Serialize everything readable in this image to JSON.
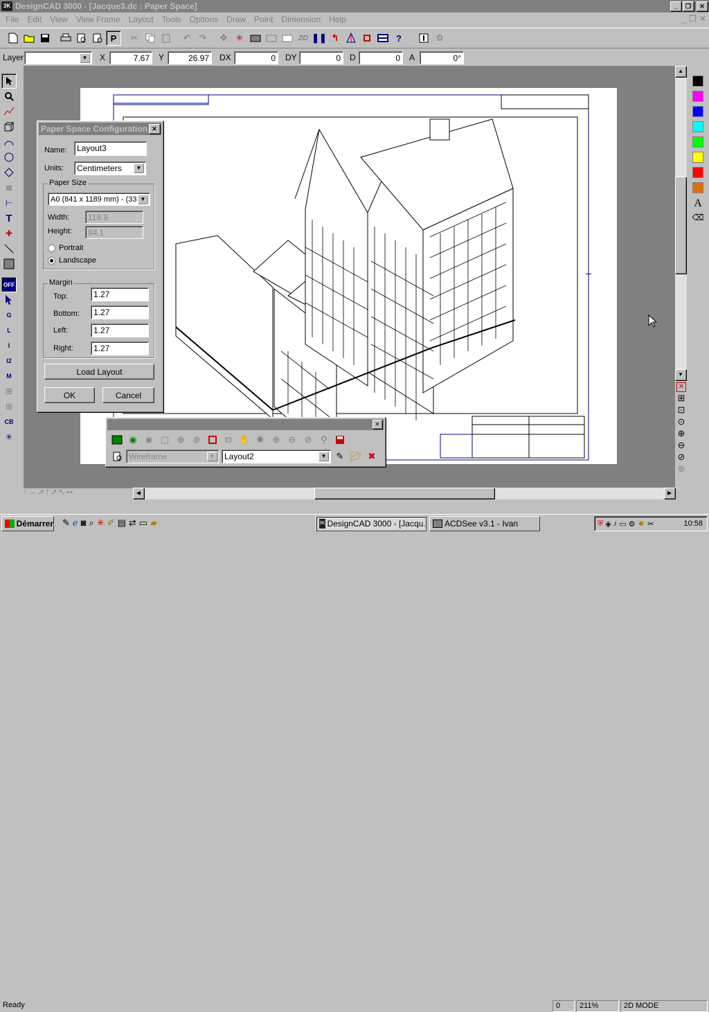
{
  "window": {
    "title": "DesignCAD 3000 - [Jacque3.dc : Paper Space]",
    "app_icon": "3K"
  },
  "title_buttons": {
    "minimize": "_",
    "restore": "❐",
    "close": "✕"
  },
  "menu": [
    "File",
    "Edit",
    "View",
    "View Frame",
    "Layout",
    "Tools",
    "Options",
    "Draw",
    "Point",
    "Dimension",
    "Help"
  ],
  "coordbar": {
    "layer_label": "Layer",
    "layer_value": "",
    "x_label": "X",
    "x": "7.67",
    "y_label": "Y",
    "y": "26.97",
    "dx_label": "DX",
    "dx": "0",
    "dy_label": "DY",
    "dy": "0",
    "d_label": "D",
    "d": "0",
    "a_label": "A",
    "a": "0°"
  },
  "toolbar_icons": [
    "new-file-icon",
    "open-file-icon",
    "save-icon",
    "print-icon",
    "print-preview-icon",
    "page-preview-icon",
    "paper-space-icon",
    "cut-icon",
    "copy-icon",
    "paste-icon",
    "undo-icon",
    "redo-icon",
    "move-icon",
    "explode-icon",
    "render-icon",
    "shade-icon",
    "hatch-icon",
    "2d-icon",
    "pause-icon",
    "arrow-icon",
    "3d-view-icon",
    "snap-icon",
    "layer-icon",
    "help-icon",
    "info-icon",
    "settings-icon"
  ],
  "toolbar_text": {
    "2d": "2D",
    "paper": "P",
    "help": "?"
  },
  "left_tools": {
    "off": "OFF",
    "g": "G",
    "l": "L",
    "i": "I",
    "i2": "I2",
    "m": "M",
    "cb": "CB",
    "text": "T"
  },
  "palette": {
    "colors": [
      "#000000",
      "#ff00ff",
      "#0000ff",
      "#00ffff",
      "#00ff00",
      "#ffff00",
      "#ff0000",
      "#ff8000"
    ],
    "text_tool": "A"
  },
  "dialog": {
    "title": "Paper Space Configuration",
    "close": "✕",
    "name_label": "Name:",
    "name": "Layout3",
    "units_label": "Units:",
    "units": "Centimeters",
    "paper_size_label": "Paper Size",
    "paper_size": "A0 (841 x 1189 mm) - (33",
    "width_label": "Width:",
    "width": "118.9",
    "height_label": "Height:",
    "height": "84.1",
    "portrait": "Portrait",
    "landscape": "Landscape",
    "orientation": "landscape",
    "margin_label": "Margin",
    "top_label": "Top:",
    "top": "1.27",
    "bottom_label": "Bottom:",
    "bottom": "1.27",
    "left_label": "Left:",
    "left": "1.27",
    "right_label": "Right:",
    "right": "1.27",
    "load_layout": "Load Layout",
    "ok": "OK",
    "cancel": "Cancel"
  },
  "float_toolbar": {
    "view_mode": "Wireframe",
    "layout": "Layout2",
    "close": "✕"
  },
  "status": {
    "ready": "Ready",
    "count": "0",
    "zoom": "211%",
    "mode": "2D MODE"
  },
  "taskbar": {
    "start": "Démarrer",
    "tasks": [
      "DesignCAD 3000 - [Jacqu...",
      "ACDSee v3.1 - Ivan"
    ],
    "clock": "10:58"
  }
}
